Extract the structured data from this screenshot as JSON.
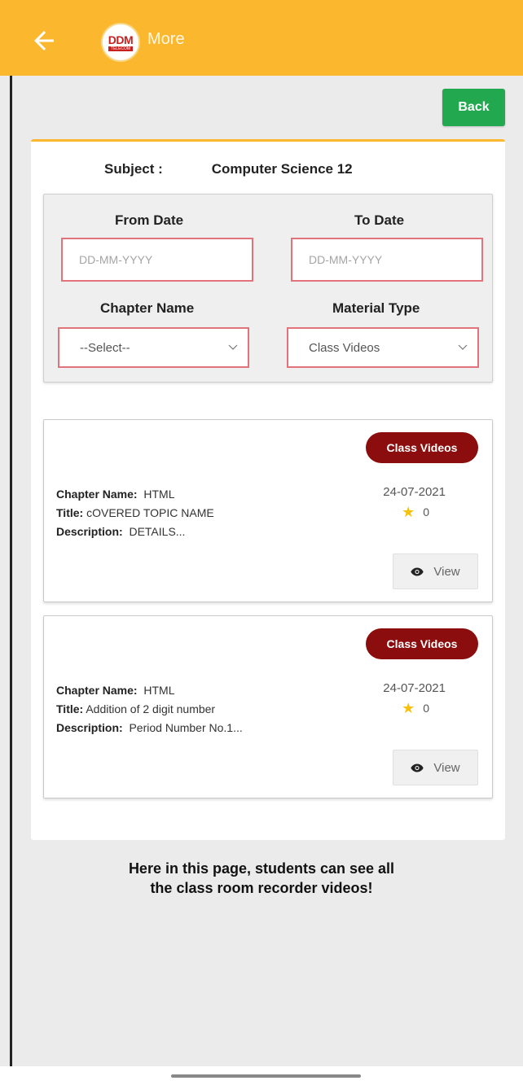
{
  "appbar": {
    "title": "More",
    "logo_text": "DDM",
    "logo_sub": "TELECOM"
  },
  "actions": {
    "back_label": "Back"
  },
  "subject": {
    "label": "Subject :",
    "value": "Computer Science 12"
  },
  "filters": {
    "from_date_label": "From Date",
    "to_date_label": "To Date",
    "from_date_placeholder": "DD-MM-YYYY",
    "to_date_placeholder": "DD-MM-YYYY",
    "chapter_label": "Chapter Name",
    "chapter_value": "--Select--",
    "material_label": "Material Type",
    "material_value": "Class Videos"
  },
  "items": [
    {
      "badge": "Class Videos",
      "chapter_label": "Chapter Name:",
      "chapter": "HTML",
      "title_label": "Title:",
      "title": "cOVERED TOPIC NAME",
      "description_label": "Description:",
      "description": "DETAILS...",
      "date": "24-07-2021",
      "rating": "0",
      "view_label": "View"
    },
    {
      "badge": "Class Videos",
      "chapter_label": "Chapter Name:",
      "chapter": "HTML",
      "title_label": "Title:",
      "title": "Addition of 2 digit number",
      "description_label": "Description:",
      "description": "Period Number No.1...",
      "date": "24-07-2021",
      "rating": "0",
      "view_label": "View"
    }
  ],
  "caption": {
    "line1": "Here in this page, students can see all",
    "line2": "the class room recorder videos!"
  },
  "colors": {
    "appbar": "#fbb72d",
    "back_button": "#22a94f",
    "badge": "#8c0d0d",
    "input_border": "#e3737a",
    "star": "#f4c20d"
  }
}
